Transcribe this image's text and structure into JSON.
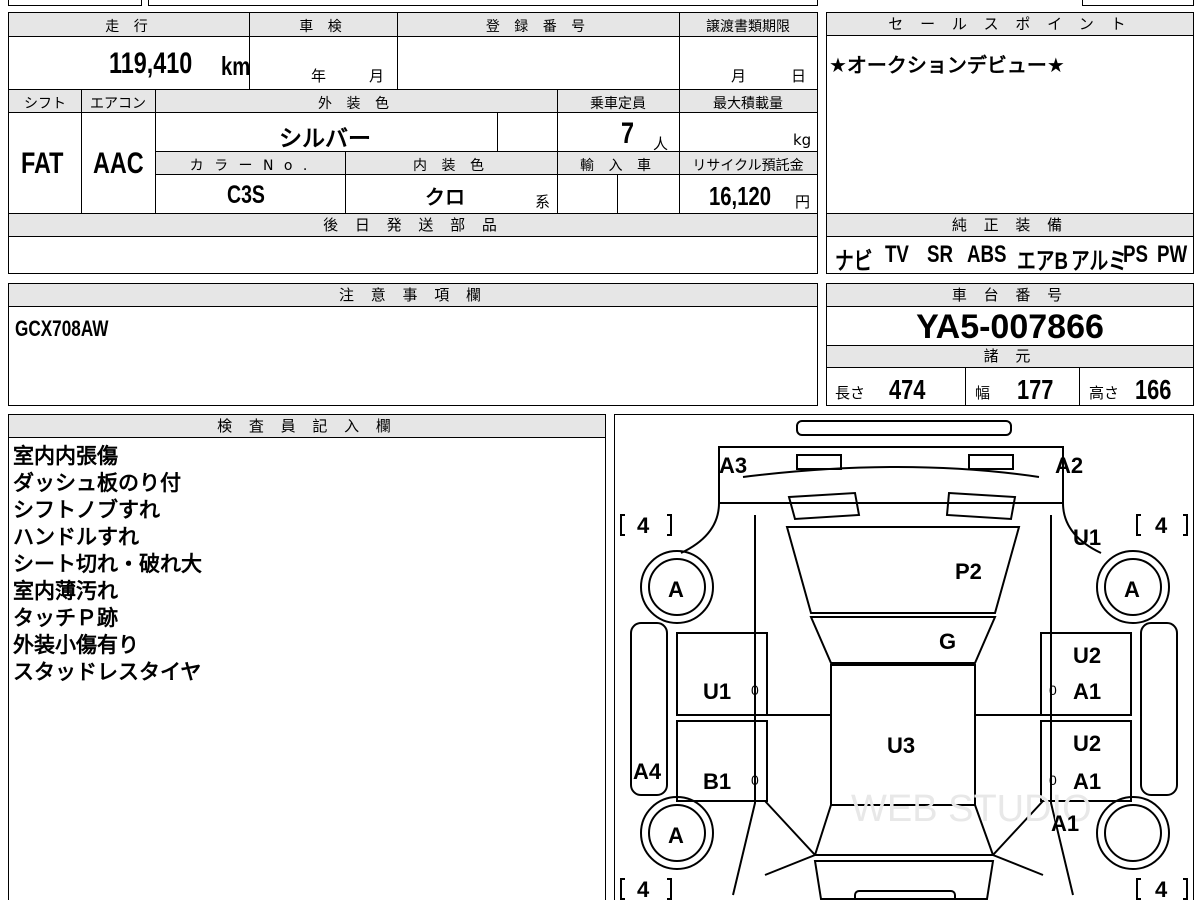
{
  "vehicle": {
    "mileage_label": "走 行",
    "mileage_value": "119,410",
    "mileage_unit": "km",
    "inspection_label": "車 検",
    "inspection_year_unit": "年",
    "inspection_month_unit": "月",
    "registration_label": "登 録 番 号",
    "transfer_label": "譲渡書類期限",
    "transfer_month_unit": "月",
    "transfer_day_unit": "日",
    "shift_label": "シフト",
    "shift_value": "FAT",
    "ac_label": "エアコン",
    "ac_value": "AAC",
    "exterior_label": "外 装 色",
    "exterior_value": "シルバー",
    "capacity_label": "乗車定員",
    "capacity_value": "7",
    "capacity_unit": "人",
    "maxload_label": "最大積載量",
    "maxload_unit": "kg",
    "colorno_label": "カ ラ ー N o .",
    "colorno_value": "C3S",
    "interior_label": "内 装 色",
    "interior_value": "クロ",
    "interior_unit": "系",
    "import_label": "輸 入 車",
    "recycle_label": "リサイクル預託金",
    "recycle_value": "16,120",
    "recycle_unit": "円",
    "parts_label": "後 日 発 送 部 品"
  },
  "sales_point": {
    "label": "セ ー ル ス ポ イ ン ト",
    "text": "★オークションデビュー★"
  },
  "equipment": {
    "label": "純 正 装 備",
    "items": [
      "ナビ",
      "TV",
      "SR",
      "ABS",
      "エアB",
      "アルミ",
      "PS",
      "PW"
    ]
  },
  "notes": {
    "label": "注 意 事 項 欄",
    "text": "GCX708AW"
  },
  "chassis": {
    "label": "車 台 番 号",
    "value": "YA5-007866",
    "specs_label": "諸 元",
    "length_label": "長さ",
    "length_value": "474",
    "width_label": "幅",
    "width_value": "177",
    "height_label": "高さ",
    "height_value": "166"
  },
  "inspector": {
    "label": "検 査 員 記 入 欄",
    "lines": [
      "室内内張傷",
      "ダッシュ板のり付",
      "シフトノブすれ",
      "ハンドルすれ",
      "シート切れ・破れ大",
      "室内薄汚れ",
      "タッチＰ跡",
      "外装小傷有り",
      "スタッドレスタイヤ"
    ]
  },
  "diagram": {
    "marks": {
      "a3": "A3",
      "a2": "A2",
      "u1_top": "U1",
      "p2": "P2",
      "g": "G",
      "u2_mid": "U2",
      "a1_mid": "A1",
      "u1_left": "U1",
      "u3": "U3",
      "u2_low": "U2",
      "a1_low": "A1",
      "a4": "A4",
      "b1": "B1",
      "a1_bottom": "A1"
    },
    "tire_tl": "4",
    "tire_tr": "4",
    "tire_bl": "4",
    "tire_br": "4",
    "tire_grade_fl": "A",
    "tire_grade_fr": "A",
    "tire_grade_rl": "A",
    "zero_1": "0",
    "zero_2": "0",
    "zero_3": "0",
    "zero_4": "0",
    "watermark": "WEB STUDIO"
  }
}
